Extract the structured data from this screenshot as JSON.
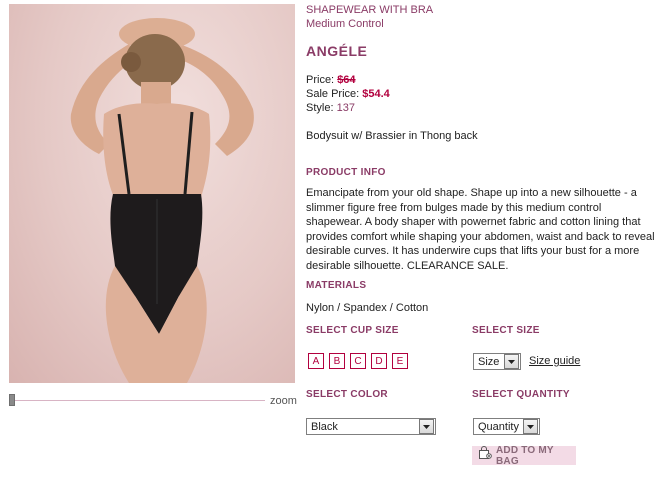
{
  "product": {
    "category": "SHAPEWEAR WITH BRA",
    "control": "Medium Control",
    "name": "ANGÉLE",
    "price_label": "Price:",
    "price": "$64",
    "sale_price_label": "Sale Price:",
    "sale_price": "$54.4",
    "style_label": "Style:",
    "style": "137",
    "short_description": "Bodysuit w/ Brassier in Thong back"
  },
  "product_info": {
    "heading": "PRODUCT INFO",
    "lines": [
      "Emancipate from your old shape. Shape up into a new silhouette - a",
      "slimmer figure free from bulges made by this medium control",
      "shapewear. A body shaper with powernet fabric and cotton lining that",
      "provides comfort while shaping your abdomen, waist and back to reveal",
      "desirable curves. It has underwire cups that lifts your bust for a more",
      "desirable silhouette. CLEARANCE SALE."
    ]
  },
  "materials": {
    "heading": "MATERIALS",
    "value": "Nylon / Spandex / Cotton"
  },
  "cup_size": {
    "heading": "SELECT CUP SIZE",
    "options": [
      "A",
      "B",
      "C",
      "D",
      "E"
    ]
  },
  "size": {
    "heading": "SELECT  SIZE",
    "selected": "Size",
    "guide_label": "Size guide"
  },
  "color": {
    "heading": "SELECT COLOR",
    "selected": "Black"
  },
  "quantity": {
    "heading": "SELECT QUANTITY",
    "selected": "Quantity"
  },
  "add_to_bag": {
    "label": "ADD TO MY BAG",
    "icon": "shopping-bag-icon"
  },
  "zoom": {
    "label": "zoom",
    "level": 0
  },
  "colors": {
    "accent": "#8a3b66",
    "price": "#b2003e",
    "button_bg": "#f3dbe6"
  }
}
